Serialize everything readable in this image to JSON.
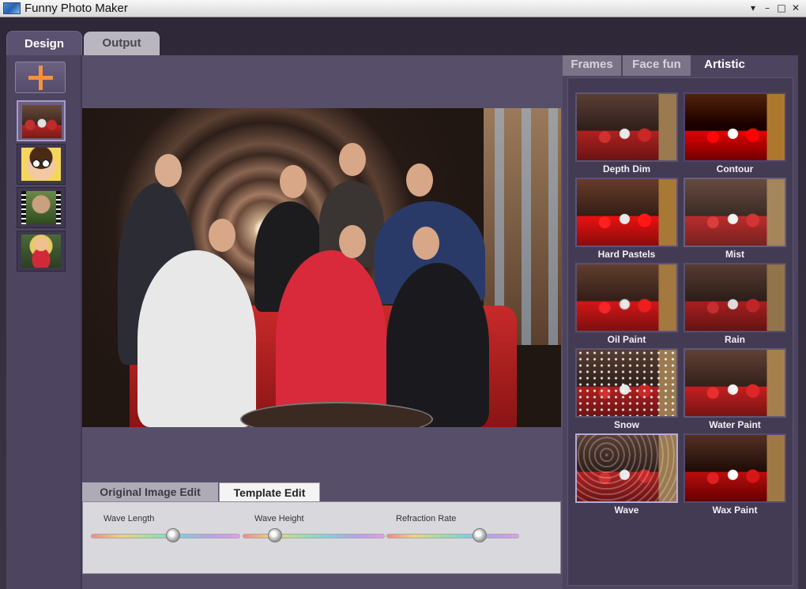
{
  "window": {
    "title": "Funny Photo Maker",
    "controls": [
      "▾",
      "–",
      "□",
      "✕"
    ]
  },
  "main_tabs": [
    {
      "label": "Design",
      "active": true
    },
    {
      "label": "Output",
      "active": false
    }
  ],
  "left_rail": {
    "add_label": "+",
    "thumbnails": [
      {
        "name": "group-photo",
        "selected": true
      },
      {
        "name": "cartoon-face",
        "selected": false
      },
      {
        "name": "film-strip-portrait",
        "selected": false
      },
      {
        "name": "woman-portrait",
        "selected": false
      }
    ]
  },
  "edit_tabs": [
    {
      "label": "Original Image Edit",
      "active": false
    },
    {
      "label": "Template Edit",
      "active": true
    }
  ],
  "sliders": [
    {
      "label": "Wave Length",
      "value": 0.55
    },
    {
      "label": "Wave Height",
      "value": 0.23
    },
    {
      "label": "Refraction Rate",
      "value": 0.7
    }
  ],
  "effect_tabs": [
    {
      "label": "Frames",
      "active": false
    },
    {
      "label": "Face fun",
      "active": false
    },
    {
      "label": "Artistic",
      "active": true
    }
  ],
  "effects": [
    {
      "label": "Depth Dim"
    },
    {
      "label": "Contour"
    },
    {
      "label": "Hard Pastels"
    },
    {
      "label": "Mist"
    },
    {
      "label": "Oil Paint"
    },
    {
      "label": "Rain"
    },
    {
      "label": "Snow"
    },
    {
      "label": "Water Paint"
    },
    {
      "label": "Wave",
      "selected": true
    },
    {
      "label": "Wax Paint"
    }
  ],
  "colors": {
    "accent_orange": "#f5923e",
    "panel_purple": "#574f69"
  }
}
